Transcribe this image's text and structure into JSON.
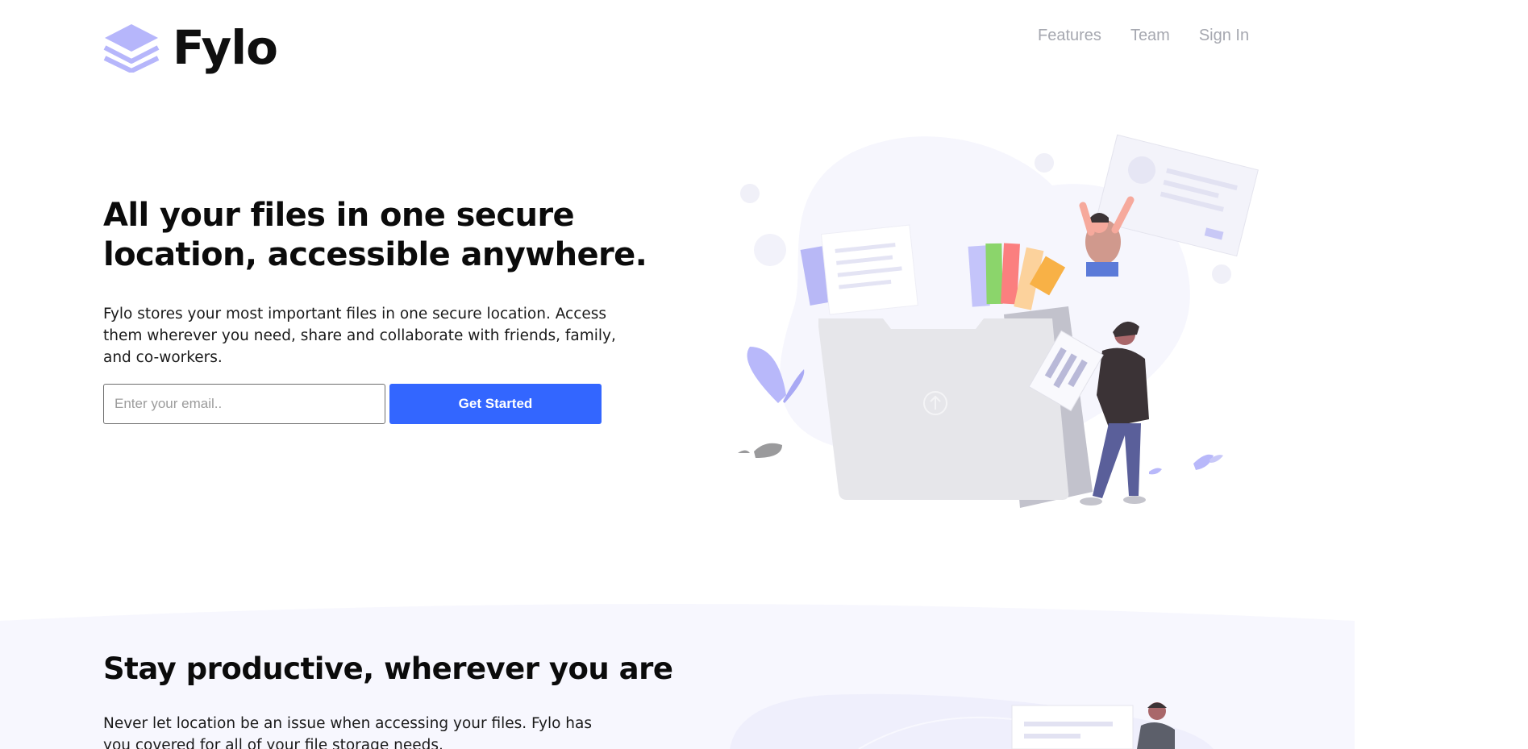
{
  "header": {
    "brand": "Fylo",
    "nav": [
      {
        "label": "Features"
      },
      {
        "label": "Team"
      },
      {
        "label": "Sign In"
      }
    ]
  },
  "hero": {
    "title": "All your files in one secure location, accessible anywhere.",
    "description": "Fylo stores your most important files in one secure location. Access them wherever you need, share and collaborate with friends, family, and co-workers.",
    "email_placeholder": "Enter your email..",
    "cta_label": "Get Started"
  },
  "productive": {
    "title": "Stay productive, wherever you are",
    "description": "Never let location be an issue when accessing your files. Fylo has you covered for all of your file storage needs."
  },
  "colors": {
    "accent": "#3366ff",
    "logo": "#b6b6fb",
    "section_bg": "#f7f7fe"
  },
  "icons": [
    "logo-layers-icon",
    "upload-arrow-icon"
  ]
}
